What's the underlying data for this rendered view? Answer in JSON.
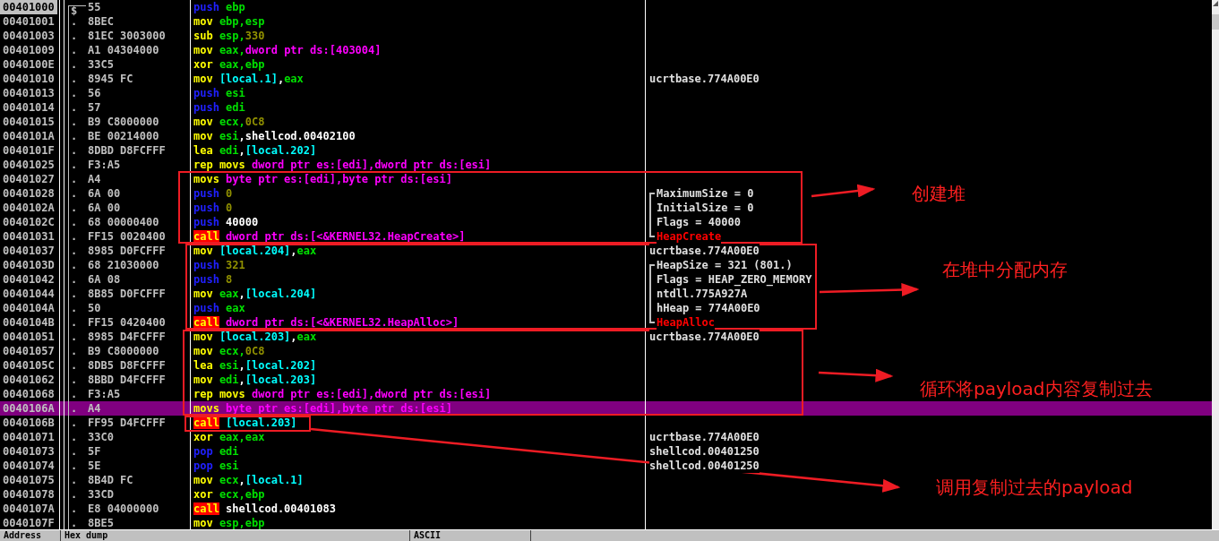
{
  "rows": [
    {
      "address": "00401000",
      "current": true,
      "selected": false,
      "marker": "$",
      "hex": "55",
      "code": [
        {
          "text": "push",
          "kind": "stack"
        },
        {
          "text": "ebp",
          "kind": "reg"
        }
      ]
    },
    {
      "address": "00401001",
      "current": false,
      "selected": false,
      "marker": ".",
      "hex": "8BEC",
      "code": [
        {
          "text": "mov",
          "kind": "op"
        },
        {
          "text": "ebp,esp",
          "kind": "reg"
        }
      ]
    },
    {
      "address": "00401003",
      "current": false,
      "selected": false,
      "marker": ".",
      "hex": "81EC 3003000",
      "code": [
        {
          "text": "sub",
          "kind": "op"
        },
        {
          "text": "esp,",
          "kind": "reg"
        },
        {
          "text": "330",
          "kind": "const"
        }
      ]
    },
    {
      "address": "00401009",
      "current": false,
      "selected": false,
      "marker": ".",
      "hex": "A1 04304000",
      "code": [
        {
          "text": "mov",
          "kind": "op"
        },
        {
          "text": "eax,",
          "kind": "reg"
        },
        {
          "text": "dword ptr ds:[403004]",
          "kind": "mem"
        }
      ]
    },
    {
      "address": "0040100E",
      "current": false,
      "selected": false,
      "marker": ".",
      "hex": "33C5",
      "code": [
        {
          "text": "xor",
          "kind": "op"
        },
        {
          "text": "eax,ebp",
          "kind": "reg"
        }
      ]
    },
    {
      "address": "00401010",
      "current": false,
      "selected": false,
      "marker": ".",
      "hex": "8945 FC",
      "code": [
        {
          "text": "mov",
          "kind": "op"
        },
        {
          "text": "[local.1]",
          "kind": "local"
        },
        {
          "text": ","
        },
        {
          "text": "eax",
          "kind": "reg"
        }
      ],
      "comment": {
        "text": "ucrtbase.774A00E0"
      }
    },
    {
      "address": "00401013",
      "current": false,
      "selected": false,
      "marker": ".",
      "hex": "56",
      "code": [
        {
          "text": "push",
          "kind": "stack"
        },
        {
          "text": "esi",
          "kind": "reg"
        }
      ]
    },
    {
      "address": "00401014",
      "current": false,
      "selected": false,
      "marker": ".",
      "hex": "57",
      "code": [
        {
          "text": "push",
          "kind": "stack"
        },
        {
          "text": "edi",
          "kind": "reg"
        }
      ]
    },
    {
      "address": "00401015",
      "current": false,
      "selected": false,
      "marker": ".",
      "hex": "B9 C8000000",
      "code": [
        {
          "text": "mov",
          "kind": "op"
        },
        {
          "text": "ecx,",
          "kind": "reg"
        },
        {
          "text": "0C8",
          "kind": "const"
        }
      ]
    },
    {
      "address": "0040101A",
      "current": false,
      "selected": false,
      "marker": ".",
      "hex": "BE 00214000",
      "code": [
        {
          "text": "mov",
          "kind": "op"
        },
        {
          "text": "esi",
          "kind": "reg"
        },
        {
          "text": ",shellcod.00402100"
        }
      ]
    },
    {
      "address": "0040101F",
      "current": false,
      "selected": false,
      "marker": ".",
      "hex": "8DBD D8FCFFF",
      "code": [
        {
          "text": "lea",
          "kind": "op"
        },
        {
          "text": "edi",
          "kind": "reg"
        },
        {
          "text": ","
        },
        {
          "text": "[local.202]",
          "kind": "local"
        }
      ]
    },
    {
      "address": "00401025",
      "current": false,
      "selected": false,
      "marker": ".",
      "hex": "F3:A5",
      "code": [
        {
          "text": "rep movs",
          "kind": "op"
        },
        {
          "text": "dword ptr es:[edi],dword ptr ds:[esi]",
          "kind": "mem"
        }
      ]
    },
    {
      "address": "00401027",
      "current": false,
      "selected": false,
      "marker": ".",
      "hex": "A4",
      "code": [
        {
          "text": "movs",
          "kind": "op"
        },
        {
          "text": "byte ptr es:[edi],byte ptr ds:[esi]",
          "kind": "mem"
        }
      ]
    },
    {
      "address": "00401028",
      "current": false,
      "selected": false,
      "marker": ".",
      "hex": "6A 00",
      "code": [
        {
          "text": "push",
          "kind": "stack"
        },
        {
          "text": "0",
          "kind": "const"
        }
      ],
      "comment": {
        "text": "MaximumSize = 0",
        "grouped": true
      }
    },
    {
      "address": "0040102A",
      "current": false,
      "selected": false,
      "marker": ".",
      "hex": "6A 00",
      "code": [
        {
          "text": "push",
          "kind": "stack"
        },
        {
          "text": "0",
          "kind": "const"
        }
      ],
      "comment": {
        "text": "InitialSize = 0",
        "grouped": true
      }
    },
    {
      "address": "0040102C",
      "current": false,
      "selected": false,
      "marker": ".",
      "hex": "68 00000400",
      "code": [
        {
          "text": "push",
          "kind": "stack"
        },
        {
          "text": "40000"
        }
      ],
      "comment": {
        "text": "Flags = 40000",
        "grouped": true
      }
    },
    {
      "address": "00401031",
      "current": false,
      "selected": false,
      "marker": ".",
      "hex": "FF15 0020400",
      "code": [
        {
          "text": "call",
          "kind": "call"
        },
        {
          "text": "dword ptr ds:[<&KERNEL32.HeapCreate>]",
          "kind": "mem"
        }
      ],
      "comment": {
        "text": "HeapCreate",
        "grouped": true,
        "kind": "api"
      }
    },
    {
      "address": "00401037",
      "current": false,
      "selected": false,
      "marker": ".",
      "hex": "8985 D0FCFFF",
      "code": [
        {
          "text": "mov",
          "kind": "op"
        },
        {
          "text": "[local.204]",
          "kind": "local"
        },
        {
          "text": ","
        },
        {
          "text": "eax",
          "kind": "reg"
        }
      ],
      "comment": {
        "text": "ucrtbase.774A00E0"
      }
    },
    {
      "address": "0040103D",
      "current": false,
      "selected": false,
      "marker": ".",
      "hex": "68 21030000",
      "code": [
        {
          "text": "push",
          "kind": "stack"
        },
        {
          "text": "321",
          "kind": "const"
        }
      ],
      "comment": {
        "text": "HeapSize = 321 (801.)",
        "grouped": true
      }
    },
    {
      "address": "00401042",
      "current": false,
      "selected": false,
      "marker": ".",
      "hex": "6A 08",
      "code": [
        {
          "text": "push",
          "kind": "stack"
        },
        {
          "text": "8",
          "kind": "const"
        }
      ],
      "comment": {
        "text": "Flags = HEAP_ZERO_MEMORY",
        "grouped": true
      }
    },
    {
      "address": "00401044",
      "current": false,
      "selected": false,
      "marker": ".",
      "hex": "8B85 D0FCFFF",
      "code": [
        {
          "text": "mov",
          "kind": "op"
        },
        {
          "text": "eax",
          "kind": "reg"
        },
        {
          "text": ","
        },
        {
          "text": "[local.204]",
          "kind": "local"
        }
      ],
      "comment": {
        "text": "ntdll.775A927A",
        "grouped": true
      }
    },
    {
      "address": "0040104A",
      "current": false,
      "selected": false,
      "marker": ".",
      "hex": "50",
      "code": [
        {
          "text": "push",
          "kind": "stack"
        },
        {
          "text": "eax",
          "kind": "reg"
        }
      ],
      "comment": {
        "text": "hHeap = 774A00E0",
        "grouped": true
      }
    },
    {
      "address": "0040104B",
      "current": false,
      "selected": false,
      "marker": ".",
      "hex": "FF15 0420400",
      "code": [
        {
          "text": "call",
          "kind": "call"
        },
        {
          "text": "dword ptr ds:[<&KERNEL32.HeapAlloc>]",
          "kind": "mem"
        }
      ],
      "comment": {
        "text": "HeapAlloc",
        "grouped": true,
        "kind": "api"
      }
    },
    {
      "address": "00401051",
      "current": false,
      "selected": false,
      "marker": ".",
      "hex": "8985 D4FCFFF",
      "code": [
        {
          "text": "mov",
          "kind": "op"
        },
        {
          "text": "[local.203]",
          "kind": "local"
        },
        {
          "text": ","
        },
        {
          "text": "eax",
          "kind": "reg"
        }
      ],
      "comment": {
        "text": "ucrtbase.774A00E0"
      }
    },
    {
      "address": "00401057",
      "current": false,
      "selected": false,
      "marker": ".",
      "hex": "B9 C8000000",
      "code": [
        {
          "text": "mov",
          "kind": "op"
        },
        {
          "text": "ecx,",
          "kind": "reg"
        },
        {
          "text": "0C8",
          "kind": "const"
        }
      ]
    },
    {
      "address": "0040105C",
      "current": false,
      "selected": false,
      "marker": ".",
      "hex": "8DB5 D8FCFFF",
      "code": [
        {
          "text": "lea",
          "kind": "op"
        },
        {
          "text": "esi",
          "kind": "reg"
        },
        {
          "text": ","
        },
        {
          "text": "[local.202]",
          "kind": "local"
        }
      ]
    },
    {
      "address": "00401062",
      "current": false,
      "selected": false,
      "marker": ".",
      "hex": "8BBD D4FCFFF",
      "code": [
        {
          "text": "mov",
          "kind": "op"
        },
        {
          "text": "edi",
          "kind": "reg"
        },
        {
          "text": ","
        },
        {
          "text": "[local.203]",
          "kind": "local"
        }
      ]
    },
    {
      "address": "00401068",
      "current": false,
      "selected": false,
      "marker": ".",
      "hex": "F3:A5",
      "code": [
        {
          "text": "rep movs",
          "kind": "op"
        },
        {
          "text": "dword ptr es:[edi],dword ptr ds:[esi]",
          "kind": "mem"
        }
      ]
    },
    {
      "address": "0040106A",
      "current": false,
      "selected": true,
      "marker": ".",
      "hex": "A4",
      "code": [
        {
          "text": "movs",
          "kind": "op"
        },
        {
          "text": "byte ptr es:[edi],byte ptr ds:[esi]",
          "kind": "mem"
        }
      ]
    },
    {
      "address": "0040106B",
      "current": false,
      "selected": false,
      "marker": ".",
      "hex": "FF95 D4FCFFF",
      "code": [
        {
          "text": "call",
          "kind": "call"
        },
        {
          "text": "[local.203]",
          "kind": "local"
        }
      ]
    },
    {
      "address": "00401071",
      "current": false,
      "selected": false,
      "marker": ".",
      "hex": "33C0",
      "code": [
        {
          "text": "xor",
          "kind": "op"
        },
        {
          "text": "eax,eax",
          "kind": "reg"
        }
      ],
      "comment": {
        "text": "ucrtbase.774A00E0"
      }
    },
    {
      "address": "00401073",
      "current": false,
      "selected": false,
      "marker": ".",
      "hex": "5F",
      "code": [
        {
          "text": "pop",
          "kind": "stack"
        },
        {
          "text": "edi",
          "kind": "reg"
        }
      ],
      "comment": {
        "text": "shellcod.00401250"
      }
    },
    {
      "address": "00401074",
      "current": false,
      "selected": false,
      "marker": ".",
      "hex": "5E",
      "code": [
        {
          "text": "pop",
          "kind": "stack"
        },
        {
          "text": "esi",
          "kind": "reg"
        }
      ],
      "comment": {
        "text": "shellcod.00401250"
      }
    },
    {
      "address": "00401075",
      "current": false,
      "selected": false,
      "marker": ".",
      "hex": "8B4D FC",
      "code": [
        {
          "text": "mov",
          "kind": "op"
        },
        {
          "text": "ecx",
          "kind": "reg"
        },
        {
          "text": ","
        },
        {
          "text": "[local.1]",
          "kind": "local"
        }
      ]
    },
    {
      "address": "00401078",
      "current": false,
      "selected": false,
      "marker": ".",
      "hex": "33CD",
      "code": [
        {
          "text": "xor",
          "kind": "op"
        },
        {
          "text": "ecx,ebp",
          "kind": "reg"
        }
      ]
    },
    {
      "address": "0040107A",
      "current": false,
      "selected": false,
      "marker": ".",
      "hex": "E8 04000000",
      "code": [
        {
          "text": "call",
          "kind": "call"
        },
        {
          "text": "shellcod.00401083"
        }
      ]
    },
    {
      "address": "0040107F",
      "current": false,
      "selected": false,
      "marker": ".",
      "hex": "8BE5",
      "code": [
        {
          "text": "mov",
          "kind": "op"
        },
        {
          "text": "esp,ebp",
          "kind": "reg"
        }
      ]
    }
  ],
  "annotations": [
    {
      "text": "创建堆"
    },
    {
      "text": "在堆中分配内存"
    },
    {
      "text": "循环将payload内容复制过去"
    },
    {
      "text": "调用复制过去的payload"
    }
  ],
  "dump_header": [
    "Address",
    "Hex dump",
    "ASCII"
  ]
}
